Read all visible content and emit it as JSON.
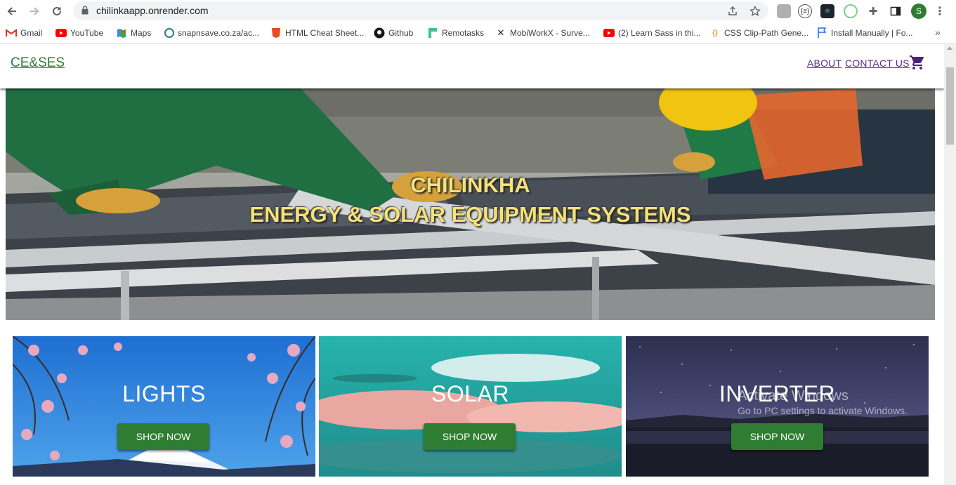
{
  "browser": {
    "url": "chilinkaapp.onrender.com",
    "profile_initial": "S",
    "bookmarks": [
      {
        "label": "Gmail",
        "icon": "gmail-icon"
      },
      {
        "label": "YouTube",
        "icon": "youtube-icon"
      },
      {
        "label": "Maps",
        "icon": "maps-icon"
      },
      {
        "label": "snapnsave.co.za/ac...",
        "icon": "snapnsave-icon"
      },
      {
        "label": "HTML Cheat Sheet...",
        "icon": "html-icon"
      },
      {
        "label": "Github",
        "icon": "github-icon"
      },
      {
        "label": "Remotasks",
        "icon": "remotasks-icon"
      },
      {
        "label": "MobiWorkX - Surve...",
        "icon": "mobiworkx-icon"
      },
      {
        "label": "(2) Learn Sass in thi...",
        "icon": "youtube-icon"
      },
      {
        "label": "CSS Clip-Path Gene...",
        "icon": "css-icon"
      },
      {
        "label": "Install Manually | Fo...",
        "icon": "flag-icon"
      }
    ],
    "bookmarks_overflow": "»"
  },
  "site": {
    "brand": "CE&SES",
    "nav": {
      "about": "ABOUT",
      "contact": "CONTACT US"
    },
    "hero": {
      "line1": "CHILINKHA",
      "line2": "ENERGY & SOLAR EQUIPMENT SYSTEMS"
    },
    "tiles": [
      {
        "title": "LIGHTS",
        "button": "SHOP NOW"
      },
      {
        "title": "SOLAR",
        "button": "SHOP NOW"
      },
      {
        "title": "INVERTER",
        "button": "SHOP NOW"
      }
    ]
  },
  "watermark": {
    "title": "Activate Windows",
    "subtitle": "Go to PC settings to activate Windows."
  },
  "colors": {
    "brand_green": "#2e7d32",
    "nav_purple": "#5b2c8a",
    "hero_text": "#f4e17a"
  }
}
